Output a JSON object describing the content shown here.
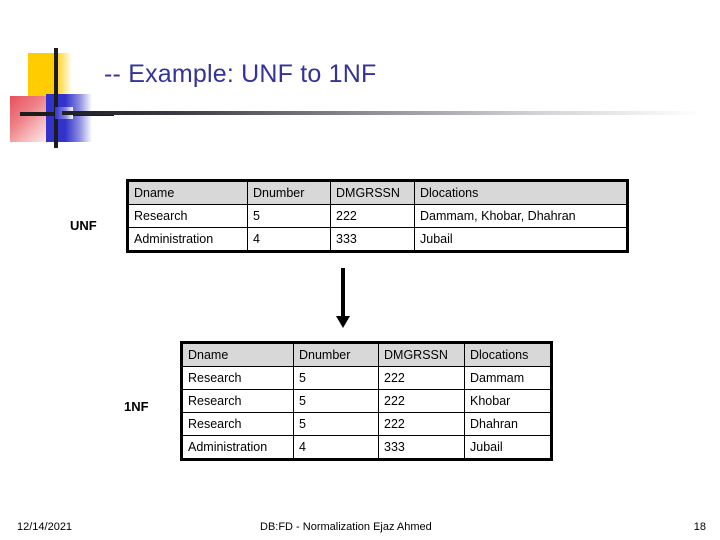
{
  "slide": {
    "title": "-- Example: UNF to 1NF",
    "title_color": "#333399",
    "accent_colors": {
      "yellow": "#FFCC00",
      "blue": "#3333CC",
      "red": "#E8505A",
      "bar": "#1C1C1C",
      "header_fill": "#D8D8D8"
    }
  },
  "labels": {
    "unf": "UNF",
    "onenf": "1NF"
  },
  "unf_table": {
    "headers": [
      "Dname",
      "Dnumber",
      "DMGRSSN",
      "Dlocations"
    ],
    "rows": [
      [
        "Research",
        "5",
        "222",
        "Dammam, Khobar, Dhahran"
      ],
      [
        "Administration",
        "4",
        "333",
        "Jubail"
      ]
    ]
  },
  "onenf_table": {
    "headers": [
      "Dname",
      "Dnumber",
      "DMGRSSN",
      "Dlocations"
    ],
    "rows": [
      [
        "Research",
        "5",
        "222",
        "Dammam"
      ],
      [
        "Research",
        "5",
        "222",
        "Khobar"
      ],
      [
        "Research",
        "5",
        "222",
        "Dhahran"
      ],
      [
        "Administration",
        "4",
        "333",
        "Jubail"
      ]
    ]
  },
  "arrow": {
    "direction": "down"
  },
  "footer": {
    "date": "12/14/2021",
    "center": "DB:FD - Normalization   Ejaz Ahmed",
    "page": "18"
  }
}
